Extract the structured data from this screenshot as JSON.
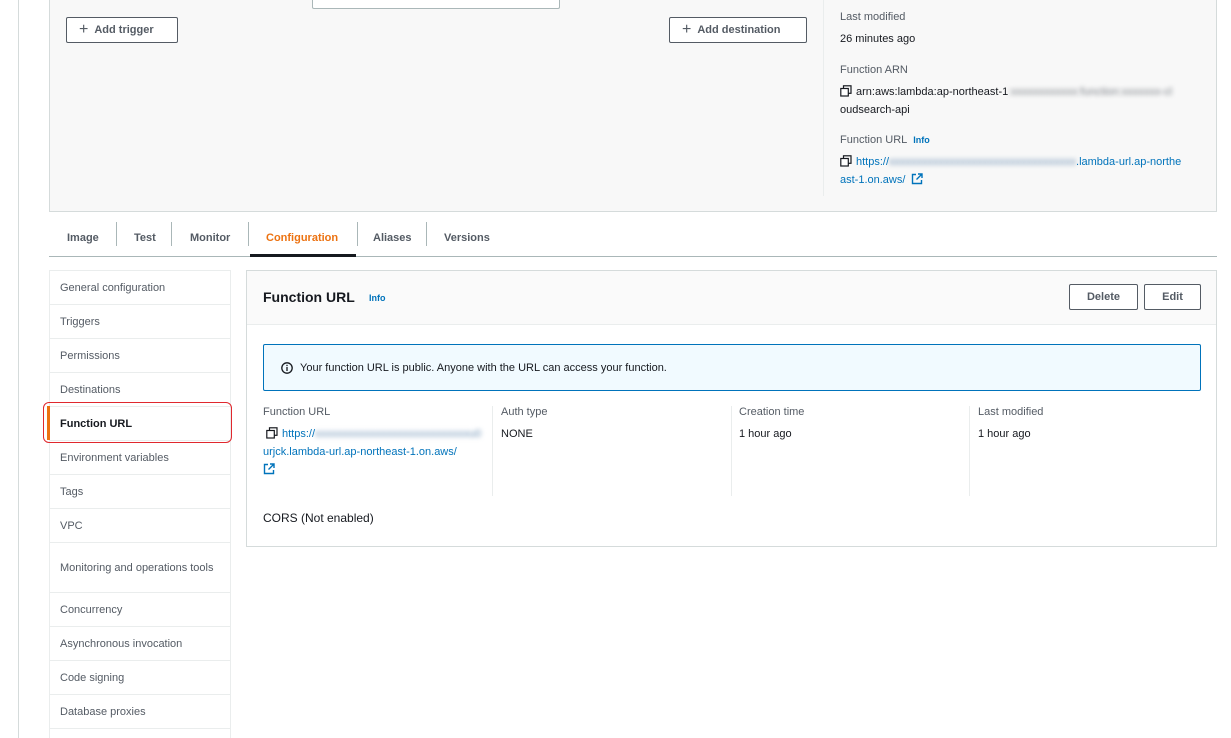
{
  "top_panel": {
    "add_trigger_label": "Add trigger",
    "add_destination_label": "Add destination",
    "last_modified_label": "Last modified",
    "last_modified_value": "26 minutes ago",
    "function_arn_label": "Function ARN",
    "function_arn_prefix": "arn:aws:lambda:ap-northeast-1",
    "function_arn_redacted": ":xxxxxxxxxxxx:function:xxxxxxx-cl",
    "function_arn_suffix": "oudsearch-api",
    "function_url_label": "Function URL",
    "function_url_info": "Info",
    "function_url_prefix": "https://",
    "function_url_redacted": "xxxxxxxxxxxxxxxxxxxxxxxxxxxxxxxxxx",
    "function_url_suffix1": ".lambda-url.ap-northe",
    "function_url_suffix2": "ast-1.on.aws/"
  },
  "tabs": [
    {
      "label": "Image"
    },
    {
      "label": "Test"
    },
    {
      "label": "Monitor"
    },
    {
      "label": "Configuration",
      "active": true
    },
    {
      "label": "Aliases"
    },
    {
      "label": "Versions"
    }
  ],
  "sidebar": {
    "items": [
      {
        "label": "General configuration"
      },
      {
        "label": "Triggers"
      },
      {
        "label": "Permissions"
      },
      {
        "label": "Destinations"
      },
      {
        "label": "Function URL",
        "active": true
      },
      {
        "label": "Environment variables"
      },
      {
        "label": "Tags"
      },
      {
        "label": "VPC"
      },
      {
        "label": "Monitoring and operations tools"
      },
      {
        "label": "Concurrency"
      },
      {
        "label": "Asynchronous invocation"
      },
      {
        "label": "Code signing"
      },
      {
        "label": "Database proxies"
      }
    ]
  },
  "main": {
    "title": "Function URL",
    "info": "Info",
    "delete_label": "Delete",
    "edit_label": "Edit",
    "alert_text": "Your function URL is public. Anyone with the URL can access your function.",
    "url_label": "Function URL",
    "url_prefix": "https://",
    "url_redacted": "xxxxxxxxxxxxxxxxxxxxxxxxxxxxu0",
    "url_line2": "urjck.lambda-url.ap-northeast-1.on.aws/",
    "auth_label": "Auth type",
    "auth_value": "NONE",
    "creation_label": "Creation time",
    "creation_value": "1 hour ago",
    "modified_label": "Last modified",
    "modified_value": "1 hour ago",
    "cors_text": "CORS (Not enabled)"
  },
  "colors": {
    "accent": "#ec7211",
    "link": "#0073bb",
    "highlight": "#e0282e"
  }
}
